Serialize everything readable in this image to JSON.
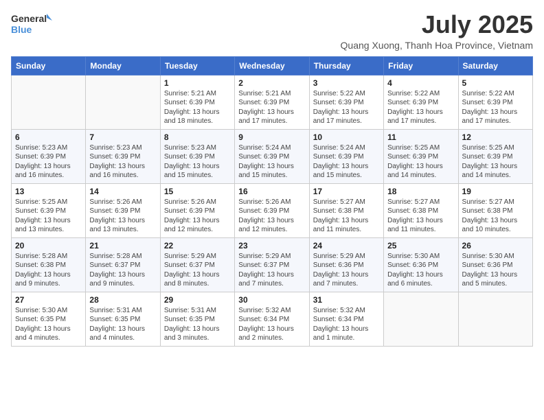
{
  "logo": {
    "general": "General",
    "blue": "Blue"
  },
  "title": "July 2025",
  "subtitle": "Quang Xuong, Thanh Hoa Province, Vietnam",
  "days_of_week": [
    "Sunday",
    "Monday",
    "Tuesday",
    "Wednesday",
    "Thursday",
    "Friday",
    "Saturday"
  ],
  "weeks": [
    [
      {
        "day": "",
        "info": ""
      },
      {
        "day": "",
        "info": ""
      },
      {
        "day": "1",
        "info": "Sunrise: 5:21 AM\nSunset: 6:39 PM\nDaylight: 13 hours and 18 minutes."
      },
      {
        "day": "2",
        "info": "Sunrise: 5:21 AM\nSunset: 6:39 PM\nDaylight: 13 hours and 17 minutes."
      },
      {
        "day": "3",
        "info": "Sunrise: 5:22 AM\nSunset: 6:39 PM\nDaylight: 13 hours and 17 minutes."
      },
      {
        "day": "4",
        "info": "Sunrise: 5:22 AM\nSunset: 6:39 PM\nDaylight: 13 hours and 17 minutes."
      },
      {
        "day": "5",
        "info": "Sunrise: 5:22 AM\nSunset: 6:39 PM\nDaylight: 13 hours and 17 minutes."
      }
    ],
    [
      {
        "day": "6",
        "info": "Sunrise: 5:23 AM\nSunset: 6:39 PM\nDaylight: 13 hours and 16 minutes."
      },
      {
        "day": "7",
        "info": "Sunrise: 5:23 AM\nSunset: 6:39 PM\nDaylight: 13 hours and 16 minutes."
      },
      {
        "day": "8",
        "info": "Sunrise: 5:23 AM\nSunset: 6:39 PM\nDaylight: 13 hours and 15 minutes."
      },
      {
        "day": "9",
        "info": "Sunrise: 5:24 AM\nSunset: 6:39 PM\nDaylight: 13 hours and 15 minutes."
      },
      {
        "day": "10",
        "info": "Sunrise: 5:24 AM\nSunset: 6:39 PM\nDaylight: 13 hours and 15 minutes."
      },
      {
        "day": "11",
        "info": "Sunrise: 5:25 AM\nSunset: 6:39 PM\nDaylight: 13 hours and 14 minutes."
      },
      {
        "day": "12",
        "info": "Sunrise: 5:25 AM\nSunset: 6:39 PM\nDaylight: 13 hours and 14 minutes."
      }
    ],
    [
      {
        "day": "13",
        "info": "Sunrise: 5:25 AM\nSunset: 6:39 PM\nDaylight: 13 hours and 13 minutes."
      },
      {
        "day": "14",
        "info": "Sunrise: 5:26 AM\nSunset: 6:39 PM\nDaylight: 13 hours and 13 minutes."
      },
      {
        "day": "15",
        "info": "Sunrise: 5:26 AM\nSunset: 6:39 PM\nDaylight: 13 hours and 12 minutes."
      },
      {
        "day": "16",
        "info": "Sunrise: 5:26 AM\nSunset: 6:39 PM\nDaylight: 13 hours and 12 minutes."
      },
      {
        "day": "17",
        "info": "Sunrise: 5:27 AM\nSunset: 6:38 PM\nDaylight: 13 hours and 11 minutes."
      },
      {
        "day": "18",
        "info": "Sunrise: 5:27 AM\nSunset: 6:38 PM\nDaylight: 13 hours and 11 minutes."
      },
      {
        "day": "19",
        "info": "Sunrise: 5:27 AM\nSunset: 6:38 PM\nDaylight: 13 hours and 10 minutes."
      }
    ],
    [
      {
        "day": "20",
        "info": "Sunrise: 5:28 AM\nSunset: 6:38 PM\nDaylight: 13 hours and 9 minutes."
      },
      {
        "day": "21",
        "info": "Sunrise: 5:28 AM\nSunset: 6:37 PM\nDaylight: 13 hours and 9 minutes."
      },
      {
        "day": "22",
        "info": "Sunrise: 5:29 AM\nSunset: 6:37 PM\nDaylight: 13 hours and 8 minutes."
      },
      {
        "day": "23",
        "info": "Sunrise: 5:29 AM\nSunset: 6:37 PM\nDaylight: 13 hours and 7 minutes."
      },
      {
        "day": "24",
        "info": "Sunrise: 5:29 AM\nSunset: 6:36 PM\nDaylight: 13 hours and 7 minutes."
      },
      {
        "day": "25",
        "info": "Sunrise: 5:30 AM\nSunset: 6:36 PM\nDaylight: 13 hours and 6 minutes."
      },
      {
        "day": "26",
        "info": "Sunrise: 5:30 AM\nSunset: 6:36 PM\nDaylight: 13 hours and 5 minutes."
      }
    ],
    [
      {
        "day": "27",
        "info": "Sunrise: 5:30 AM\nSunset: 6:35 PM\nDaylight: 13 hours and 4 minutes."
      },
      {
        "day": "28",
        "info": "Sunrise: 5:31 AM\nSunset: 6:35 PM\nDaylight: 13 hours and 4 minutes."
      },
      {
        "day": "29",
        "info": "Sunrise: 5:31 AM\nSunset: 6:35 PM\nDaylight: 13 hours and 3 minutes."
      },
      {
        "day": "30",
        "info": "Sunrise: 5:32 AM\nSunset: 6:34 PM\nDaylight: 13 hours and 2 minutes."
      },
      {
        "day": "31",
        "info": "Sunrise: 5:32 AM\nSunset: 6:34 PM\nDaylight: 13 hours and 1 minute."
      },
      {
        "day": "",
        "info": ""
      },
      {
        "day": "",
        "info": ""
      }
    ]
  ]
}
